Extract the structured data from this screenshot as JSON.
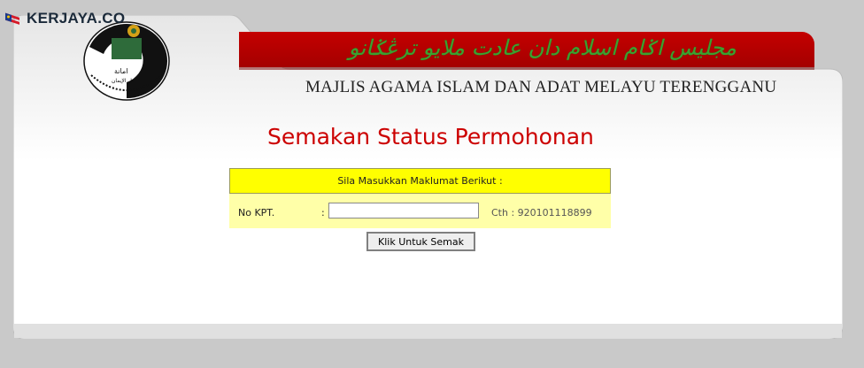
{
  "watermark": {
    "text": "KERJAYA.CO"
  },
  "header": {
    "jawi_title": "مجليس اݢام اسلام دان عادت ملايو ترڠݢانو",
    "org_name": "MAJLIS AGAMA ISLAM DAN ADAT MELAYU TERENGGANU",
    "logo_text_top": "امانة",
    "logo_text_mid": "دار الإيمان"
  },
  "page": {
    "title": "Semakan Status Permohonan"
  },
  "form": {
    "header": "Sila Masukkan Maklumat Berikut :",
    "label": "No KPT.",
    "colon": ":",
    "input_value": "",
    "example": "Cth : 920101118899",
    "submit_label": "Klik Untuk Semak"
  },
  "colors": {
    "banner": "#b80000",
    "title": "#cc0000",
    "form_header": "#ffff00",
    "form_body": "#ffffa8"
  }
}
